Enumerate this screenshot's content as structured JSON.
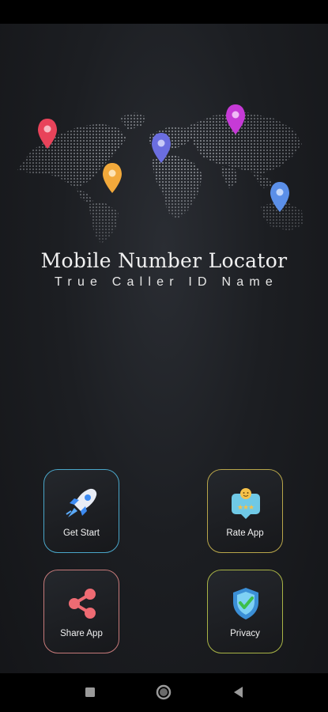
{
  "app": {
    "title": "Mobile Number Locator",
    "subtitle": "True Caller ID Name"
  },
  "menu": {
    "get_start": "Get Start",
    "rate_app": "Rate App",
    "share_app": "Share App",
    "privacy": "Privacy"
  },
  "map_pins": [
    {
      "name": "red-pin",
      "color": "#e8435a"
    },
    {
      "name": "orange-pin",
      "color": "#f2a93b"
    },
    {
      "name": "violet-pin",
      "color": "#6b6ee0"
    },
    {
      "name": "magenta-pin",
      "color": "#c63ad6"
    },
    {
      "name": "blue-pin",
      "color": "#5b8fe8"
    }
  ],
  "icons": {
    "get_start": "rocket-icon",
    "rate_app": "rating-icon",
    "share_app": "share-icon",
    "privacy": "shield-check-icon",
    "nav_recents": "square-icon",
    "nav_home": "circle-icon",
    "nav_back": "triangle-back-icon"
  },
  "colors": {
    "background": "#1c1e22",
    "tile_border_get_start": "#4aa6c9",
    "tile_border_rate_app": "#b8a64a",
    "tile_border_share_app": "#c67a7a",
    "tile_border_privacy": "#a9b446"
  }
}
